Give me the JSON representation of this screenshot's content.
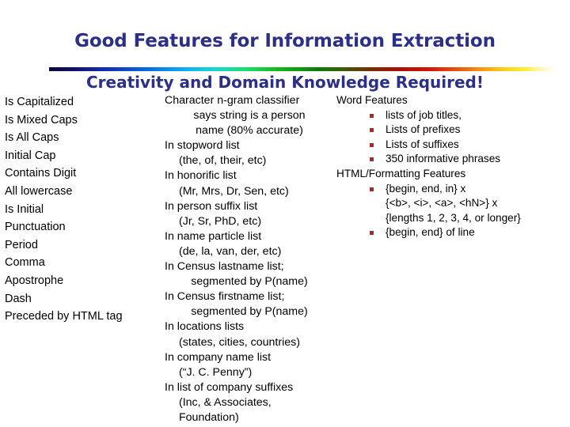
{
  "slide": {
    "title": "Good Features for Information Extraction",
    "subtitle": "Creativity and Domain Knowledge Required!",
    "title_color": "#2c2f86",
    "bullet_color": "#b02727",
    "background_color": "#ffffff"
  },
  "columns": {
    "left": {
      "items": [
        "Is Capitalized",
        "Is Mixed Caps",
        "Is All Caps",
        "Initial Cap",
        "Contains Digit",
        "All lowercase",
        "Is Initial",
        "Punctuation",
        "Period",
        "Comma",
        "Apostrophe",
        "Dash",
        "Preceded by HTML tag"
      ]
    },
    "middle": {
      "groups": [
        {
          "head": "Character n-gram classifier",
          "subs": [
            "says string is a person",
            "name (80% accurate)"
          ],
          "sub_align": [
            "center",
            "center"
          ]
        },
        {
          "head": "In stopword list",
          "subs": [
            "(the, of, their, etc)"
          ],
          "sub_align": [
            "indent"
          ]
        },
        {
          "head": "In honorific list",
          "subs": [
            "(Mr, Mrs, Dr, Sen, etc)"
          ],
          "sub_align": [
            "indent"
          ]
        },
        {
          "head": "In person suffix list",
          "subs": [
            "(Jr, Sr, PhD, etc)"
          ],
          "sub_align": [
            "indent"
          ]
        },
        {
          "head": "In name particle list",
          "subs": [
            "(de, la, van, der, etc)"
          ],
          "sub_align": [
            "indent"
          ]
        },
        {
          "head": "In Census lastname list;",
          "subs": [
            "segmented by P(name)"
          ],
          "sub_align": [
            "center"
          ]
        },
        {
          "head": "In Census firstname list;",
          "subs": [
            "segmented by P(name)"
          ],
          "sub_align": [
            "center"
          ]
        },
        {
          "head": "In locations lists",
          "subs": [
            "(states, cities, countries)"
          ],
          "sub_align": [
            "indent"
          ]
        },
        {
          "head": "In company name list",
          "subs": [
            "(“J. C. Penny”)"
          ],
          "sub_align": [
            "indent"
          ]
        },
        {
          "head": "In list of company suffixes",
          "subs": [
            "(Inc, & Associates,",
            "Foundation)"
          ],
          "sub_align": [
            "indent",
            "indent"
          ]
        }
      ]
    },
    "right": {
      "sections": [
        {
          "head": "Word Features",
          "bullets": [
            [
              "lists of job titles,"
            ],
            [
              "Lists of prefixes"
            ],
            [
              "Lists of suffixes"
            ],
            [
              "350 informative phrases"
            ]
          ]
        },
        {
          "head": "HTML/Formatting Features",
          "bullets": [
            [
              "{begin, end, in} x",
              "{<b>, <i>, <a>, <hN>} x",
              "{lengths 1, 2, 3, 4, or longer}"
            ],
            [
              "{begin, end} of line"
            ]
          ]
        }
      ]
    }
  }
}
